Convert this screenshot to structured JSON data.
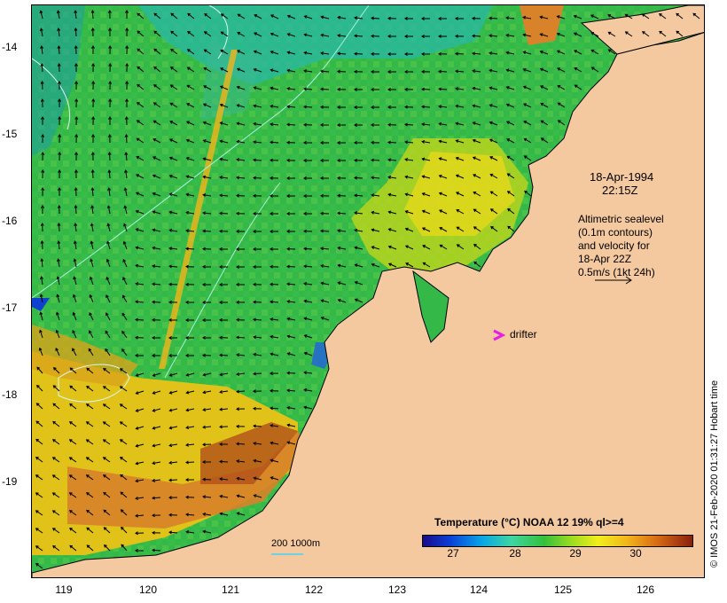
{
  "map": {
    "lat_ticks": [
      "-14",
      "-15",
      "-16",
      "-17",
      "-18",
      "-19"
    ],
    "lon_ticks": [
      "119",
      "120",
      "121",
      "122",
      "123",
      "124",
      "125",
      "126"
    ],
    "date": "18-Apr-1994",
    "time": "22:15Z",
    "legend_lines": [
      "Altimetric sealevel",
      "(0.1m contours)",
      "and velocity for",
      "18-Apr 22Z",
      "0.5m/s (1kt 24h)"
    ],
    "drifter_label": "drifter",
    "drifter_color": "#e61ee6",
    "land_color": "#f5c9a0",
    "scale_text": "200  1000m",
    "colorbar": {
      "title": "Temperature (°C) NOAA 12 19% ql>=4",
      "ticks": [
        "27",
        "28",
        "29",
        "30"
      ]
    },
    "credit": "© IMOS 21-Feb-2020 01:31:27 Hobart time"
  }
}
